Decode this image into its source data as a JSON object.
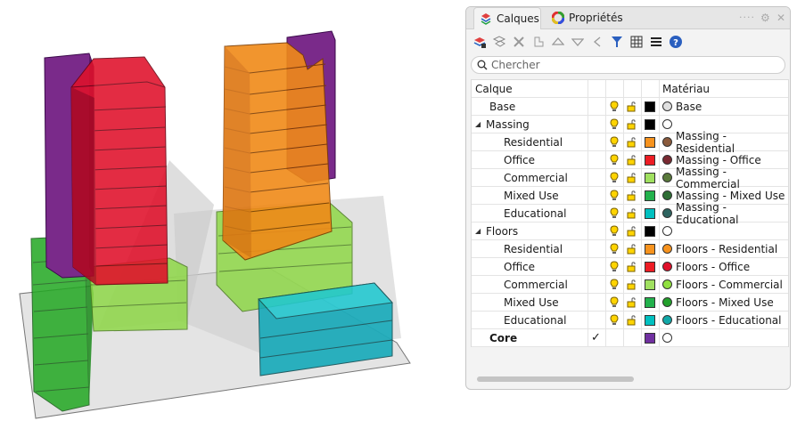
{
  "panel": {
    "tabs": [
      {
        "label": "Calques",
        "icon": "layers-icon",
        "active": true
      },
      {
        "label": "Propriétés",
        "icon": "color-wheel-icon",
        "active": false
      }
    ],
    "toolbar": [
      "new-layer-icon",
      "new-sublayer-icon",
      "delete-icon",
      "duplicate-icon",
      "move-up-icon",
      "move-down-icon",
      "move-left-icon",
      "filter-icon",
      "table-icon",
      "menu-icon",
      "help-icon"
    ],
    "search": {
      "placeholder": "Chercher",
      "value": ""
    },
    "columns": {
      "layer": "Calque",
      "material": "Matériau"
    },
    "layers": [
      {
        "name": "Base",
        "indent": 0,
        "expander": "",
        "bulb": true,
        "lock": true,
        "color": "#000000",
        "material": "Base",
        "matColor": "#e0e0e0",
        "bold": false,
        "check": false
      },
      {
        "name": "Massing",
        "indent": 0,
        "expander": "◢",
        "bulb": true,
        "lock": true,
        "color": "#000000",
        "material": "",
        "matColor": "#ffffff",
        "bold": false,
        "check": false
      },
      {
        "name": "Residential",
        "indent": 1,
        "expander": "",
        "bulb": true,
        "lock": true,
        "color": "#f7931e",
        "material": "Massing - Residential",
        "matColor": "#8a5a3c",
        "bold": false,
        "check": false
      },
      {
        "name": "Office",
        "indent": 1,
        "expander": "",
        "bulb": true,
        "lock": true,
        "color": "#ed1c24",
        "material": "Massing - Office",
        "matColor": "#7a2a32",
        "bold": false,
        "check": false
      },
      {
        "name": "Commercial",
        "indent": 1,
        "expander": "",
        "bulb": true,
        "lock": true,
        "color": "#a0e060",
        "material": "Massing - Commercial",
        "matColor": "#5a7a3c",
        "bold": false,
        "check": false
      },
      {
        "name": "Mixed Use",
        "indent": 1,
        "expander": "",
        "bulb": true,
        "lock": true,
        "color": "#22b14c",
        "material": "Massing - Mixed Use",
        "matColor": "#2e6e34",
        "bold": false,
        "check": false
      },
      {
        "name": "Educational",
        "indent": 1,
        "expander": "",
        "bulb": true,
        "lock": true,
        "color": "#00c0c0",
        "material": "Massing - Educational",
        "matColor": "#2e6460",
        "bold": false,
        "check": false
      },
      {
        "name": "Floors",
        "indent": 0,
        "expander": "◢",
        "bulb": true,
        "lock": true,
        "color": "#000000",
        "material": "",
        "matColor": "#ffffff",
        "bold": false,
        "check": false
      },
      {
        "name": "Residential",
        "indent": 1,
        "expander": "",
        "bulb": true,
        "lock": true,
        "color": "#f7931e",
        "material": "Floors - Residential",
        "matColor": "#f7931e",
        "bold": false,
        "check": false
      },
      {
        "name": "Office",
        "indent": 1,
        "expander": "",
        "bulb": true,
        "lock": true,
        "color": "#ed1c24",
        "material": "Floors - Office",
        "matColor": "#e0102a",
        "bold": false,
        "check": false
      },
      {
        "name": "Commercial",
        "indent": 1,
        "expander": "",
        "bulb": true,
        "lock": true,
        "color": "#a0e060",
        "material": "Floors - Commercial",
        "matColor": "#90e040",
        "bold": false,
        "check": false
      },
      {
        "name": "Mixed Use",
        "indent": 1,
        "expander": "",
        "bulb": true,
        "lock": true,
        "color": "#22b14c",
        "material": "Floors - Mixed Use",
        "matColor": "#22a02c",
        "bold": false,
        "check": false
      },
      {
        "name": "Educational",
        "indent": 1,
        "expander": "",
        "bulb": true,
        "lock": true,
        "color": "#00c0c0",
        "material": "Floors - Educational",
        "matColor": "#10a8a8",
        "bold": false,
        "check": false
      },
      {
        "name": "Core",
        "indent": 0,
        "expander": "",
        "bulb": false,
        "lock": false,
        "color": "#7030a0",
        "material": "",
        "matColor": "#ffffff",
        "bold": true,
        "check": true
      }
    ]
  }
}
